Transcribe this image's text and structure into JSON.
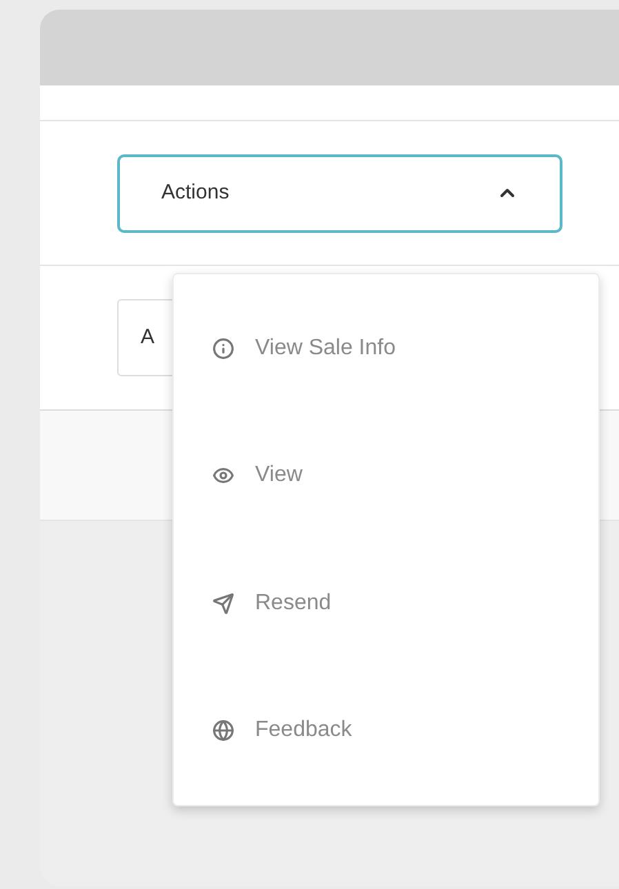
{
  "dropdown": {
    "label": "Actions",
    "expanded": true
  },
  "second_button": {
    "label": "A"
  },
  "menu": {
    "items": [
      {
        "label": "View Sale Info",
        "kind": "info"
      },
      {
        "label": "View",
        "kind": "view"
      },
      {
        "label": "Resend",
        "kind": "send"
      },
      {
        "label": "Feedback",
        "kind": "globe"
      }
    ]
  }
}
